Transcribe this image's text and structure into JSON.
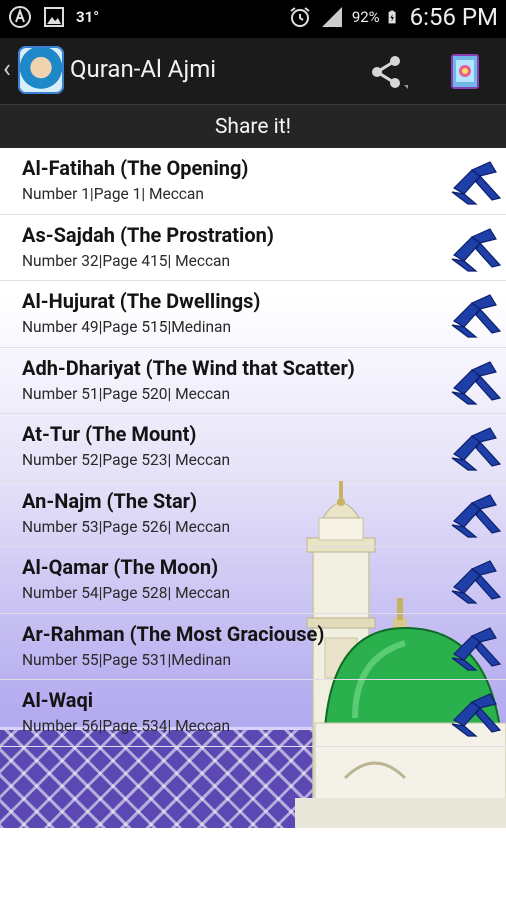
{
  "status_bar": {
    "temperature": "31°",
    "battery_percent": "92%",
    "time": "6:56 PM"
  },
  "app_bar": {
    "title": "Quran-Al Ajmi",
    "icons": [
      "back-chevron-icon",
      "reciter-avatar-icon",
      "share-icon",
      "quran-book-icon"
    ]
  },
  "share_bar": {
    "label": "Share it!"
  },
  "surahs": [
    {
      "title": "Al-Fatihah (The Opening)",
      "subtitle": "Number 1|Page 1| Meccan"
    },
    {
      "title": "As-Sajdah (The Prostration)",
      "subtitle": "Number 32|Page 415| Meccan"
    },
    {
      "title": "Al-Hujurat (The Dwellings)",
      "subtitle": "Number 49|Page 515|Medinan"
    },
    {
      "title": "Adh-Dhariyat (The Wind that Scatter)",
      "subtitle": "Number 51|Page 520| Meccan"
    },
    {
      "title": "At-Tur (The Mount)",
      "subtitle": "Number 52|Page 523| Meccan"
    },
    {
      "title": "An-Najm (The Star)",
      "subtitle": "Number 53|Page 526| Meccan"
    },
    {
      "title": "Al-Qamar (The Moon)",
      "subtitle": "Number 54|Page 528| Meccan"
    },
    {
      "title": "Ar-Rahman (The Most Graciouse)",
      "subtitle": "Number 55|Page 531|Medinan"
    },
    {
      "title": "Al-Waqi",
      "subtitle": "Number 56|Page 534| Meccan"
    }
  ],
  "colors": {
    "accent_blue": "#1f3fa8",
    "dome_green": "#27a84a",
    "pattern_purple": "#5b48b2"
  }
}
